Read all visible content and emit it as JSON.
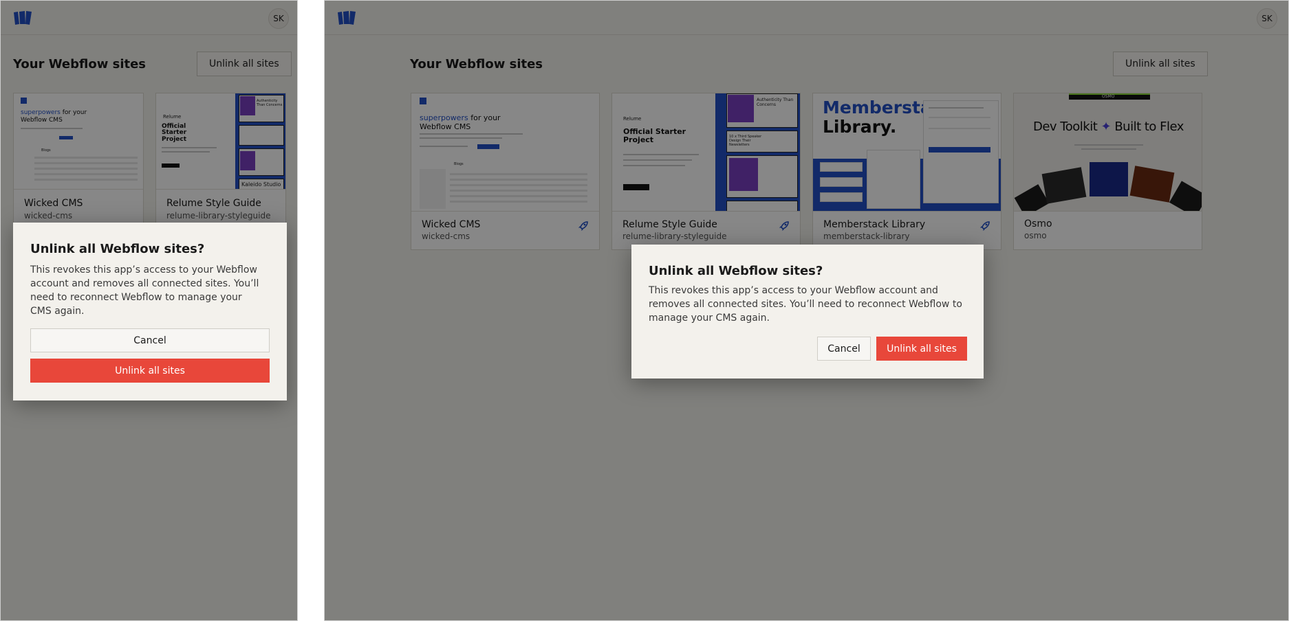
{
  "app": {
    "avatar_initials": "SK",
    "page_title": "Your Webflow sites",
    "unlink_all_label": "Unlink all sites"
  },
  "sites": [
    {
      "name": "Wicked CMS",
      "slug": "wicked-cms",
      "icon": "rocket-icon",
      "thumb": {
        "line1_accent": "superpowers",
        "line1_rest": " for your",
        "line2": "Webflow CMS",
        "table_title": "Blogs"
      }
    },
    {
      "name": "Relume Style Guide",
      "slug": "relume-library-styleguide",
      "icon": "rocket-icon",
      "thumb": {
        "brand": "Relume",
        "title": "Official Starter Project",
        "card1": "Authenticity Than Concerns",
        "card2": "10 x Third Speaker Design Their Newsletters",
        "footer": "Kaleido Studio"
      }
    },
    {
      "name": "Memberstack Library",
      "slug": "memberstack-library",
      "icon": "rocket-icon",
      "thumb": {
        "line1": "Memberstack",
        "line2": "Library."
      }
    },
    {
      "name": "Osmo",
      "slug": "osmo",
      "thumb": {
        "brand": "OSMO",
        "headline_left": "Dev Toolkit",
        "headline_right": "Built to Flex"
      }
    }
  ],
  "dialog": {
    "title": "Unlink all Webflow sites?",
    "body": "This revokes this app’s access to your Webflow account and removes all connected sites. You’ll need to reconnect Webflow to manage your CMS again.",
    "cancel_label": "Cancel",
    "confirm_label": "Unlink all sites"
  },
  "colors": {
    "danger": "#e8473a",
    "brand_blue": "#2350c6",
    "overlay": "rgba(0,0,0,0.47)",
    "surface": "#f3f1ec"
  }
}
